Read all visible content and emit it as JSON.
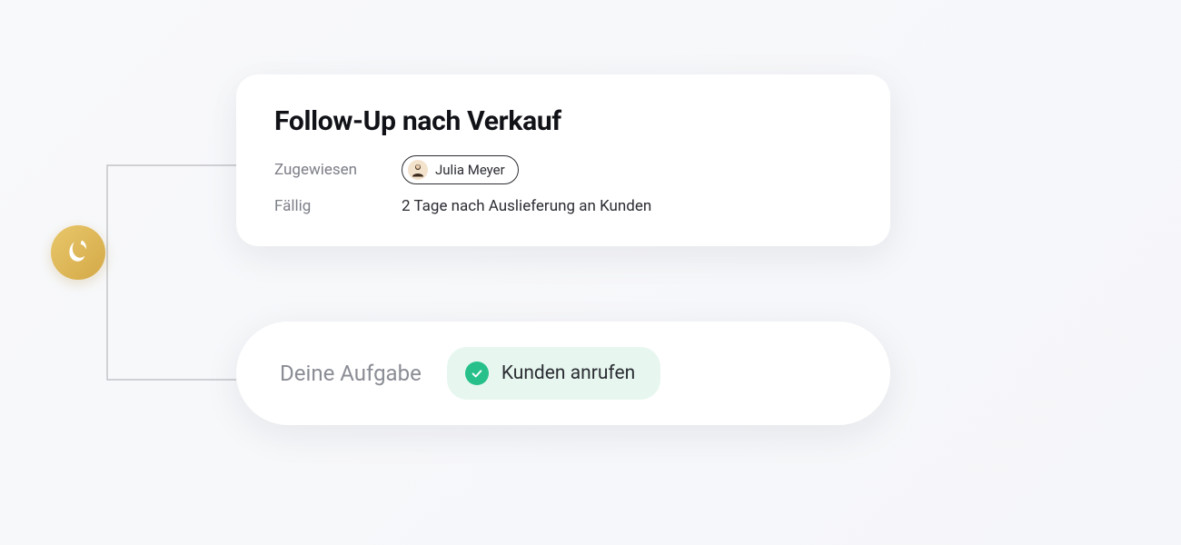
{
  "card": {
    "title": "Follow-Up nach Verkauf",
    "assigned_label": "Zugewiesen",
    "assignee_name": "Julia Meyer",
    "due_label": "Fällig",
    "due_value": "2 Tage nach Auslieferung an Kunden"
  },
  "task": {
    "heading": "Deine Aufgabe",
    "item_label": "Kunden anrufen"
  },
  "colors": {
    "logo_gradient_from": "#e8c76b",
    "logo_gradient_to": "#d4a947",
    "task_pill_bg": "#e7f7ef",
    "check_bg": "#27c08b"
  }
}
